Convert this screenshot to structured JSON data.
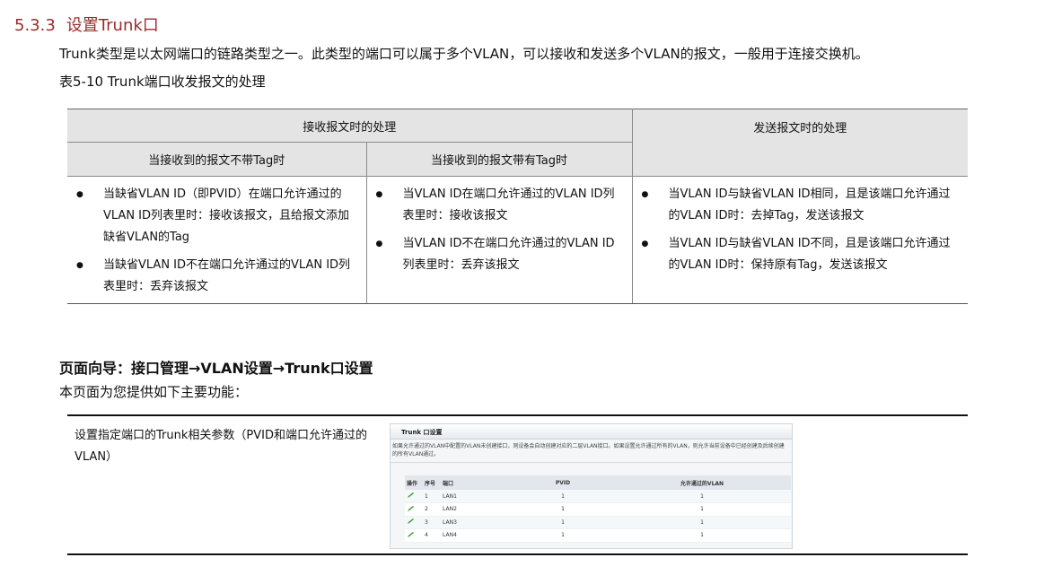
{
  "section": {
    "number": "5.3.3",
    "title": "设置Trunk口"
  },
  "intro": "Trunk类型是以太网端口的链路类型之一。此类型的端口可以属于多个VLAN，可以接收和发送多个VLAN的报文，一般用于连接交换机。",
  "table_caption": "表5-10 Trunk端口收发报文的处理",
  "table": {
    "header_receive": "接收报文时的处理",
    "header_send": "发送报文时的处理",
    "sub_no_tag": "当接收到的报文不带Tag时",
    "sub_with_tag": "当接收到的报文带有Tag时",
    "col_no_tag": [
      "当缺省VLAN ID（即PVID）在端口允许通过的VLAN ID列表里时：接收该报文，且给报文添加缺省VLAN的Tag",
      "当缺省VLAN ID不在端口允许通过的VLAN ID列表里时：丢弃该报文"
    ],
    "col_with_tag": [
      "当VLAN ID在端口允许通过的VLAN ID列表里时：接收该报文",
      "当VLAN ID不在端口允许通过的VLAN ID列表里时：丢弃该报文"
    ],
    "col_send": [
      "当VLAN ID与缺省VLAN ID相同，且是该端口允许通过的VLAN ID时：去掉Tag，发送该报文",
      "当VLAN ID与缺省VLAN ID不同，且是该端口允许通过的VLAN ID时：保持原有Tag，发送该报文"
    ]
  },
  "nav": {
    "title": "页面向导：接口管理→VLAN设置→Trunk口设置",
    "desc": "本页面为您提供如下主要功能："
  },
  "function": {
    "text": "设置指定端口的Trunk相关参数（PVID和端口允许通过的VLAN）"
  },
  "screenshot": {
    "title": "Trunk 口设置",
    "note": "如果允许通过的VLAN中配置的VLAN未创建接口，则设备会自动创建对应的二层VLAN接口。如果设置允许通过所有的VLAN，则允许当前设备中已经创建及后续创建的所有VLAN通过。",
    "columns": {
      "op": "操作",
      "seq": "序号",
      "port": "端口",
      "pvid": "PVID",
      "allowed": "允许通过的VLAN"
    },
    "rows": [
      {
        "seq": "1",
        "port": "LAN1",
        "pvid": "1",
        "allowed": "1"
      },
      {
        "seq": "2",
        "port": "LAN2",
        "pvid": "1",
        "allowed": "1"
      },
      {
        "seq": "3",
        "port": "LAN3",
        "pvid": "1",
        "allowed": "1"
      },
      {
        "seq": "4",
        "port": "LAN4",
        "pvid": "1",
        "allowed": "1"
      }
    ],
    "edit_icon": "pencil-icon",
    "edit_icon_color": "#3a9a2a"
  }
}
